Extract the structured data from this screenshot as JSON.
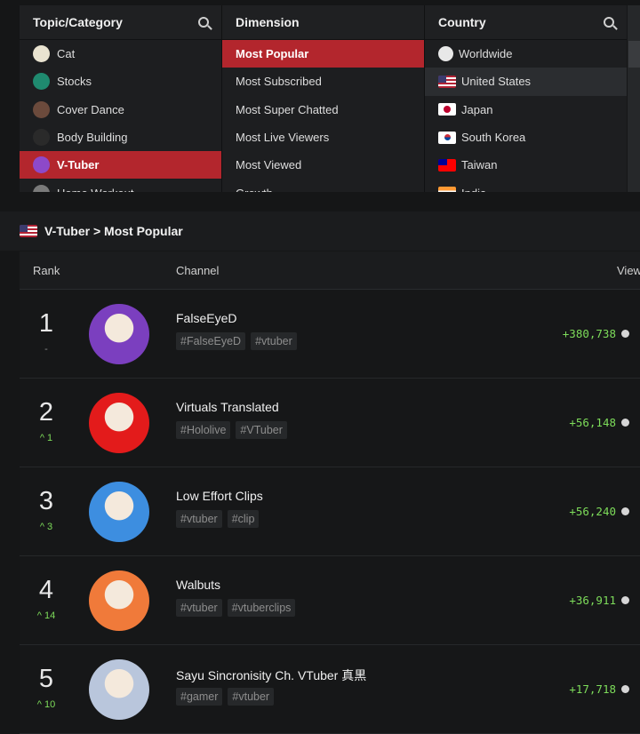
{
  "filters": {
    "topic": {
      "header": "Topic/Category",
      "items": [
        {
          "label": "Cat",
          "icon": "cat-icon",
          "color": "#e9e3d0"
        },
        {
          "label": "Stocks",
          "icon": "stocks-icon",
          "color": "#1f8a6f"
        },
        {
          "label": "Cover Dance",
          "icon": "cover-dance-icon",
          "color": "#6b4a3c"
        },
        {
          "label": "Body Building",
          "icon": "body-building-icon",
          "color": "#2a2a2a"
        },
        {
          "label": "V-Tuber",
          "icon": "vtuber-icon",
          "color": "#8d49c9",
          "selected": true
        },
        {
          "label": "Home Workout",
          "icon": "home-workout-icon",
          "color": "#7a7a7a"
        }
      ]
    },
    "dimension": {
      "header": "Dimension",
      "items": [
        {
          "label": "Most Popular",
          "selected": true
        },
        {
          "label": "Most Subscribed"
        },
        {
          "label": "Most Super Chatted"
        },
        {
          "label": "Most Live Viewers"
        },
        {
          "label": "Most Viewed"
        },
        {
          "label": "Growth"
        }
      ]
    },
    "country": {
      "header": "Country",
      "items": [
        {
          "label": "Worldwide",
          "flag": "globe"
        },
        {
          "label": "United States",
          "flag": "us",
          "highlighted": true
        },
        {
          "label": "Japan",
          "flag": "jp"
        },
        {
          "label": "South Korea",
          "flag": "kr"
        },
        {
          "label": "Taiwan",
          "flag": "tw"
        },
        {
          "label": "India",
          "flag": "in"
        }
      ]
    }
  },
  "breadcrumb": "V-Tuber > Most Popular",
  "table": {
    "headers": {
      "rank": "Rank",
      "channel": "Channel",
      "views": "Views"
    },
    "rows": [
      {
        "rank": "1",
        "change": "-",
        "up": false,
        "name": "FalseEyeD",
        "tags": [
          "#FalseEyeD",
          "#vtuber"
        ],
        "views": "+380,738",
        "avatar_color": "#7b3fbf"
      },
      {
        "rank": "2",
        "change": "1",
        "up": true,
        "name": "Virtuals Translated",
        "tags": [
          "#Hololive",
          "#VTuber"
        ],
        "views": "+56,148",
        "avatar_color": "#e31b1b"
      },
      {
        "rank": "3",
        "change": "3",
        "up": true,
        "name": "Low Effort Clips",
        "tags": [
          "#vtuber",
          "#clip"
        ],
        "views": "+56,240",
        "avatar_color": "#3d8ee0"
      },
      {
        "rank": "4",
        "change": "14",
        "up": true,
        "name": "Walbuts",
        "tags": [
          "#vtuber",
          "#vtuberclips"
        ],
        "views": "+36,911",
        "avatar_color": "#f07a3a"
      },
      {
        "rank": "5",
        "change": "10",
        "up": true,
        "name": "Sayu Sincronisity Ch. VTuber 真黒",
        "tags": [
          "#gamer",
          "#vtuber"
        ],
        "views": "+17,718",
        "avatar_color": "#b9c6dc"
      }
    ]
  },
  "colors": {
    "accent": "#b3262d",
    "growth": "#7ddc5a"
  }
}
